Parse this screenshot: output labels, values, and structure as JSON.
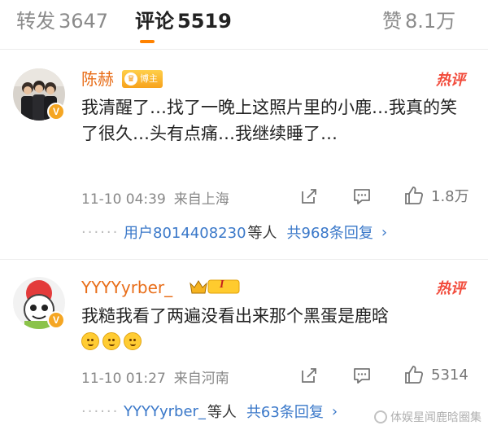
{
  "tabs": [
    {
      "label": "转发",
      "count": "3647"
    },
    {
      "label": "评论",
      "count": "5519"
    },
    {
      "label": "赞",
      "count": "8.1万"
    }
  ],
  "colors": {
    "username": "#e86d18",
    "link": "#3a78c9",
    "hot": "#f24b3b",
    "tab_underline": "#ff8200"
  },
  "comments": [
    {
      "username": "陈赫",
      "badge": "博主",
      "hot_label": "热评",
      "text": "我清醒了…找了一晚上这照片里的小鹿…我真的笑了很久…头有点痛…我继续睡了…",
      "time": "11-10 04:39",
      "location": "来自上海",
      "likes": "1.8万",
      "reply_preview_user": "用户8014408230",
      "reply_preview_suffix": "等人",
      "reply_total": "共968条回复",
      "icons": [
        "share-icon",
        "comment-icon",
        "like-icon"
      ]
    },
    {
      "username": "YYYYyrber_",
      "badge": "I",
      "hot_label": "热评",
      "text": "我糙我看了两遍没看出来那个黑蛋是鹿晗",
      "emoji_count": 3,
      "time": "11-10 01:27",
      "location": "来自河南",
      "likes": "5314",
      "reply_preview_user": "YYYYyrber_",
      "reply_preview_suffix": "等人",
      "reply_total": "共63条回复",
      "icons": [
        "share-icon",
        "comment-icon",
        "like-icon"
      ]
    }
  ],
  "watermark": "体娱星闻鹿晗圈集"
}
